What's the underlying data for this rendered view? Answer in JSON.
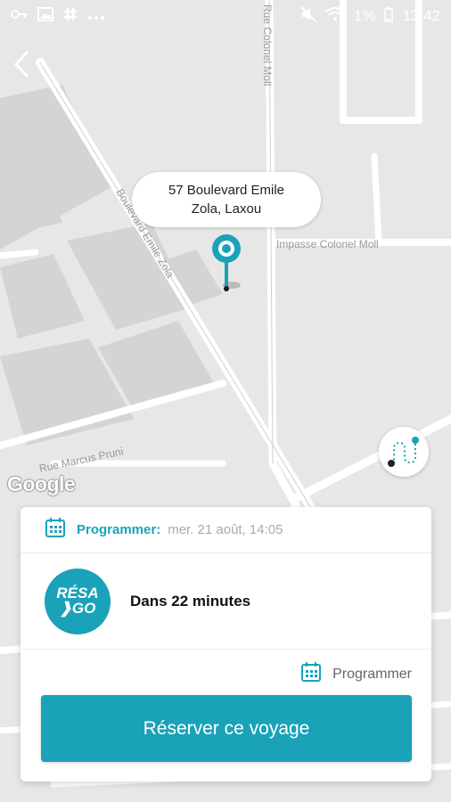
{
  "status_bar": {
    "icons_left": [
      "key-icon",
      "image-icon",
      "slack-icon",
      "more-icon"
    ],
    "icons_right": [
      "mute-icon",
      "wifi-icon",
      "battery-icon"
    ],
    "battery_percent": "1%",
    "time": "13:42"
  },
  "map": {
    "street_labels": [
      "Boulevard Emile Zola",
      "Impasse Colonel Moll",
      "Rue Colonel Moll",
      "Rue Marcus Pruni"
    ],
    "attribution": "Google"
  },
  "pin_label": {
    "line1": "57 Boulevard Emile",
    "line2": "Zola, Laxou"
  },
  "card": {
    "schedule_label": "Programmer:",
    "schedule_value": "mer. 21 août, 14:05",
    "provider_logo_line1": "RÉSA",
    "provider_logo_line2": "GO",
    "eta": "Dans 22 minutes",
    "program_link": "Programmer",
    "reserve_button": "Réserver ce voyage"
  },
  "colors": {
    "accent": "#1aa2b9",
    "map_bg": "#e7e7e7",
    "road": "#ffffff",
    "block": "#d6d6d6"
  }
}
